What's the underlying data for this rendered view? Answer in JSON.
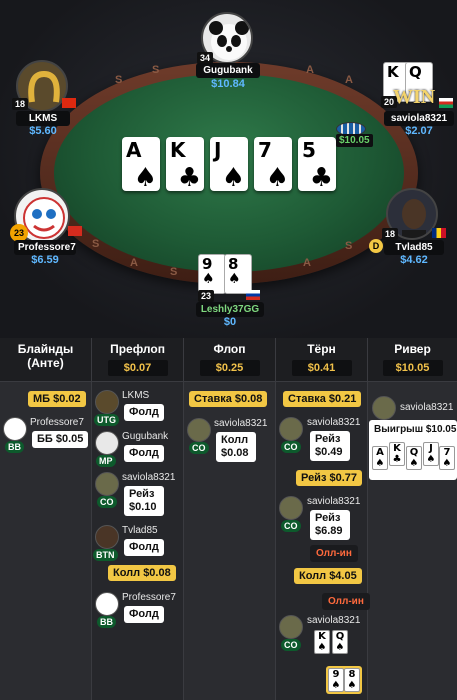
{
  "table": {
    "board_cards": [
      {
        "rank": "A",
        "suit": "♠"
      },
      {
        "rank": "K",
        "suit": "♣"
      },
      {
        "rank": "J",
        "suit": "♠"
      },
      {
        "rank": "7",
        "suit": "♠"
      },
      {
        "rank": "5",
        "suit": "♣"
      }
    ],
    "pot": "$10.05",
    "dealer_label": "D",
    "rim_letters": [
      "S",
      "S",
      "A",
      "A",
      "S",
      "A",
      "S",
      "A",
      "S"
    ],
    "seats": {
      "gugubank": {
        "name": "Gugubank",
        "stack": "$10.84",
        "level": "34"
      },
      "lkms": {
        "name": "LKMS",
        "stack": "$5.60",
        "level": "18"
      },
      "saviola": {
        "name": "saviola8321",
        "stack": "$2.07",
        "level": "20",
        "banner": "WIN",
        "cards": [
          {
            "rank": "K",
            "suit": "♠"
          },
          {
            "rank": "Q",
            "suit": "♠"
          }
        ]
      },
      "professore": {
        "name": "Professore7",
        "stack": "$6.59",
        "level": "23"
      },
      "tvlad": {
        "name": "Tvlad85",
        "stack": "$4.62",
        "level": "18"
      },
      "leshly": {
        "name": "Leshly37GG",
        "stack": "$0",
        "level": "23",
        "cards": [
          {
            "rank": "9",
            "suit": "♠"
          },
          {
            "rank": "8",
            "suit": "♠"
          }
        ]
      }
    }
  },
  "history": {
    "columns": [
      {
        "title": "Блайнды (Анте)",
        "pot": ""
      },
      {
        "title": "Префлоп",
        "pot": "$0.07"
      },
      {
        "title": "Флоп",
        "pot": "$0.25"
      },
      {
        "title": "Тёрн",
        "pot": "$0.41"
      },
      {
        "title": "Ривер",
        "pot": "$10.05"
      }
    ],
    "blinds": {
      "sb": "МБ $0.02",
      "bb_player": "Professore7",
      "bb_pos": "BB",
      "bb": "ББ $0.05"
    },
    "preflop": {
      "rows": [
        {
          "player": "LKMS",
          "pos": "UTG",
          "action": "Фолд"
        },
        {
          "player": "Gugubank",
          "pos": "MP",
          "action": "Фолд"
        },
        {
          "player": "saviola8321",
          "pos": "CO",
          "action": "Рейз $0.10"
        },
        {
          "player": "Tvlad85",
          "pos": "BTN",
          "action": "Фолд"
        },
        {
          "player": "Professore7",
          "pos": "BB",
          "action": "Фолд"
        }
      ],
      "call": "Колл $0.08"
    },
    "flop": {
      "bet": "Ставка $0.08",
      "player": "saviola8321",
      "pos": "CO",
      "action": "Колл $0.08"
    },
    "turn": {
      "bet": "Ставка $0.21",
      "player": "saviola8321",
      "pos": "CO",
      "action1": "Рейз $0.49",
      "raise": "Рейз $0.77",
      "player2": "saviola8321",
      "pos2": "CO",
      "action2": "Рейз $6.89",
      "allin": "Олл-ин",
      "call": "Колл $4.05",
      "allin2": "Олл-ин",
      "player3": "saviola8321",
      "pos3": "CO",
      "show_cards": [
        {
          "rank": "K",
          "suit": "♠"
        },
        {
          "rank": "Q",
          "suit": "♠"
        }
      ],
      "hero_cards": [
        {
          "rank": "9",
          "suit": "♠"
        },
        {
          "rank": "8",
          "suit": "♠"
        }
      ]
    },
    "river": {
      "player": "saviola8321",
      "win": "Выигрыш $10.05",
      "cards": [
        {
          "rank": "A",
          "suit": "♠"
        },
        {
          "rank": "K",
          "suit": "♣"
        },
        {
          "rank": "Q",
          "suit": "♠"
        },
        {
          "rank": "J",
          "suit": "♠"
        },
        {
          "rank": "7",
          "suit": "♠"
        }
      ]
    }
  }
}
